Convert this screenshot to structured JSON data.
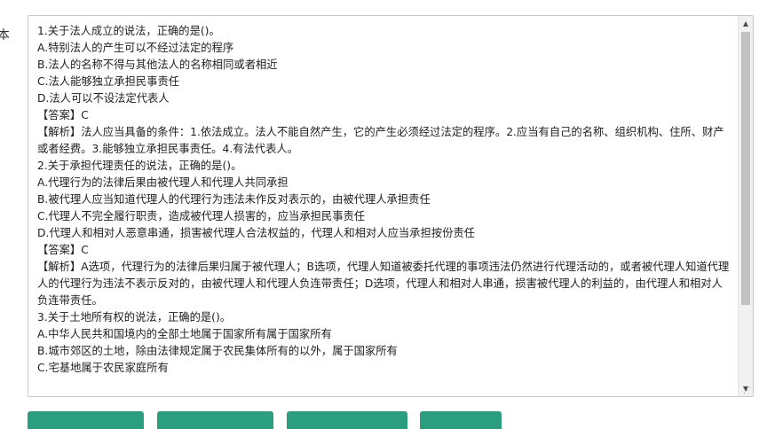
{
  "side_label": "本",
  "textarea": {
    "lines": [
      "1.关于法人成立的说法，正确的是()。",
      "A.特别法人的产生可以不经过法定的程序",
      "B.法人的名称不得与其他法人的名称相同或者相近",
      "C.法人能够独立承担民事责任",
      "D.法人可以不设法定代表人",
      "【答案】C",
      "【解析】法人应当具备的条件：1.依法成立。法人不能自然产生，它的产生必须经过法定的程序。2.应当有自己的名称、组织机构、住所、财产或者经费。3.能够独立承担民事责任。4.有法代表人。",
      "2.关于承担代理责任的说法，正确的是()。",
      "A.代理行为的法律后果由被代理人和代理人共同承担",
      "B.被代理人应当知道代理人的代理行为违法未作反对表示的，由被代理人承担责任",
      "C.代理人不完全履行职责，造成被代理人损害的，应当承担民事责任",
      "D.代理人和相对人恶意串通，损害被代理人合法权益的，代理人和相对人应当承担按份责任",
      "【答案】C",
      "【解析】A选项，代理行为的法律后果归属于被代理人；B选项，代理人知道被委托代理的事项违法仍然进行代理活动的，或者被代理人知道代理人的代理行为违法不表示反对的，由被代理人和代理人负连带责任；D选项，代理人和相对人串通，损害被代理人的利益的，由代理人和相对人负连带责任。",
      "3.关于土地所有权的说法，正确的是()。",
      "A.中华人民共和国境内的全部土地属于国家所有属于国家所有",
      "B.城市郊区的土地，除由法律规定属于农民集体所有的以外，属于国家所有",
      "C.宅基地属于农民家庭所有"
    ]
  },
  "scrollbar": {
    "position_fraction": 0.0
  }
}
